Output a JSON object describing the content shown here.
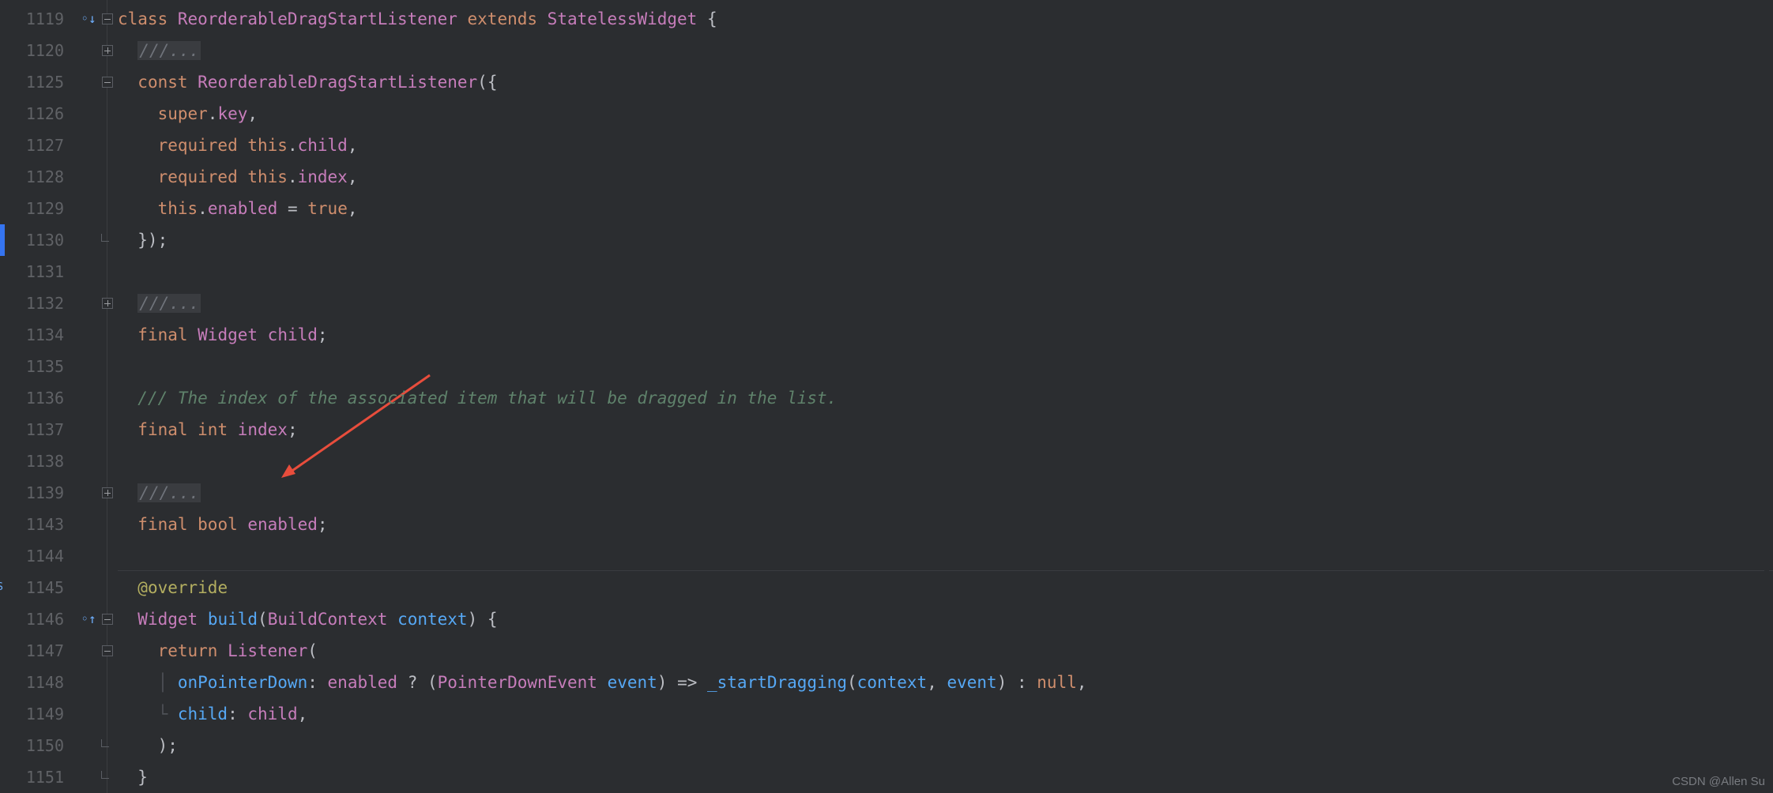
{
  "gutter": {
    "lines": [
      "1119",
      "1120",
      "1125",
      "1126",
      "1127",
      "1128",
      "1129",
      "1130",
      "1131",
      "1132",
      "1134",
      "1135",
      "1136",
      "1137",
      "1138",
      "1139",
      "1143",
      "1144",
      "1145",
      "1146",
      "1147",
      "1148",
      "1149",
      "1150",
      "1151"
    ]
  },
  "marks": {
    "l0": "◦↓",
    "l19": "◦↑",
    "extra_left_char": "S"
  },
  "code": {
    "l0": {
      "segments": [
        {
          "c": "kw",
          "t": "class "
        },
        {
          "c": "type",
          "t": "ReorderableDragStartListener "
        },
        {
          "c": "kw",
          "t": "extends "
        },
        {
          "c": "type",
          "t": "StatelessWidget "
        },
        {
          "c": "pn",
          "t": "{"
        }
      ]
    },
    "l1": {
      "segments": [
        {
          "c": "pn",
          "t": "  "
        },
        {
          "c": "comment",
          "t": "///..."
        }
      ]
    },
    "l2": {
      "segments": [
        {
          "c": "pn",
          "t": "  "
        },
        {
          "c": "kw",
          "t": "const "
        },
        {
          "c": "type",
          "t": "ReorderableDragStartListener"
        },
        {
          "c": "pn",
          "t": "({"
        }
      ]
    },
    "l3": {
      "segments": [
        {
          "c": "pn",
          "t": "    "
        },
        {
          "c": "kw",
          "t": "super"
        },
        {
          "c": "pn",
          "t": "."
        },
        {
          "c": "prop",
          "t": "key"
        },
        {
          "c": "pn",
          "t": ","
        }
      ]
    },
    "l4": {
      "segments": [
        {
          "c": "pn",
          "t": "    "
        },
        {
          "c": "kw",
          "t": "required "
        },
        {
          "c": "thiskw",
          "t": "this"
        },
        {
          "c": "pn",
          "t": "."
        },
        {
          "c": "prop",
          "t": "child"
        },
        {
          "c": "pn",
          "t": ","
        }
      ]
    },
    "l5": {
      "segments": [
        {
          "c": "pn",
          "t": "    "
        },
        {
          "c": "kw",
          "t": "required "
        },
        {
          "c": "thiskw",
          "t": "this"
        },
        {
          "c": "pn",
          "t": "."
        },
        {
          "c": "prop",
          "t": "index"
        },
        {
          "c": "pn",
          "t": ","
        }
      ]
    },
    "l6": {
      "segments": [
        {
          "c": "pn",
          "t": "    "
        },
        {
          "c": "thiskw",
          "t": "this"
        },
        {
          "c": "pn",
          "t": "."
        },
        {
          "c": "prop",
          "t": "enabled"
        },
        {
          "c": "pn",
          "t": " = "
        },
        {
          "c": "lit",
          "t": "true"
        },
        {
          "c": "pn",
          "t": ","
        }
      ]
    },
    "l7": {
      "segments": [
        {
          "c": "pn",
          "t": "  });"
        }
      ]
    },
    "l8": {
      "segments": [
        {
          "c": "pn",
          "t": ""
        }
      ]
    },
    "l9": {
      "segments": [
        {
          "c": "pn",
          "t": "  "
        },
        {
          "c": "comment",
          "t": "///..."
        }
      ]
    },
    "l10": {
      "segments": [
        {
          "c": "pn",
          "t": "  "
        },
        {
          "c": "kw",
          "t": "final "
        },
        {
          "c": "type",
          "t": "Widget "
        },
        {
          "c": "prop",
          "t": "child"
        },
        {
          "c": "pn",
          "t": ";"
        }
      ]
    },
    "l11": {
      "segments": [
        {
          "c": "pn",
          "t": ""
        }
      ]
    },
    "l12": {
      "segments": [
        {
          "c": "pn",
          "t": "  "
        },
        {
          "c": "doccomment",
          "t": "/// The index of the associated item that will be dragged in the list."
        }
      ]
    },
    "l13": {
      "segments": [
        {
          "c": "pn",
          "t": "  "
        },
        {
          "c": "kw",
          "t": "final "
        },
        {
          "c": "kw",
          "t": "int "
        },
        {
          "c": "prop",
          "t": "index"
        },
        {
          "c": "pn",
          "t": ";"
        }
      ]
    },
    "l14": {
      "segments": [
        {
          "c": "pn",
          "t": ""
        }
      ]
    },
    "l15": {
      "segments": [
        {
          "c": "pn",
          "t": "  "
        },
        {
          "c": "comment",
          "t": "///..."
        }
      ]
    },
    "l16": {
      "segments": [
        {
          "c": "pn",
          "t": "  "
        },
        {
          "c": "kw",
          "t": "final "
        },
        {
          "c": "kw",
          "t": "bool "
        },
        {
          "c": "prop",
          "t": "enabled"
        },
        {
          "c": "pn",
          "t": ";"
        }
      ]
    },
    "l17": {
      "segments": [
        {
          "c": "pn",
          "t": ""
        }
      ]
    },
    "l18": {
      "segments": [
        {
          "c": "pn",
          "t": "  "
        },
        {
          "c": "ann",
          "t": "@override"
        }
      ]
    },
    "l19": {
      "segments": [
        {
          "c": "pn",
          "t": "  "
        },
        {
          "c": "type",
          "t": "Widget "
        },
        {
          "c": "mtd",
          "t": "build"
        },
        {
          "c": "pn",
          "t": "("
        },
        {
          "c": "type",
          "t": "BuildContext "
        },
        {
          "c": "par",
          "t": "context"
        },
        {
          "c": "pn",
          "t": ") {"
        }
      ]
    },
    "l20": {
      "segments": [
        {
          "c": "pn",
          "t": "    "
        },
        {
          "c": "kw",
          "t": "return "
        },
        {
          "c": "type",
          "t": "Listener"
        },
        {
          "c": "pn",
          "t": "("
        }
      ]
    },
    "l21": {
      "segments": [
        {
          "c": "guide",
          "t": "    │ "
        },
        {
          "c": "par",
          "t": "onPointerDown"
        },
        {
          "c": "pn",
          "t": ": "
        },
        {
          "c": "prop",
          "t": "enabled"
        },
        {
          "c": "pn",
          "t": " ? ("
        },
        {
          "c": "type",
          "t": "PointerDownEvent "
        },
        {
          "c": "par",
          "t": "event"
        },
        {
          "c": "pn",
          "t": ") => "
        },
        {
          "c": "mtd",
          "t": "_startDragging"
        },
        {
          "c": "pn",
          "t": "("
        },
        {
          "c": "par",
          "t": "context"
        },
        {
          "c": "pn",
          "t": ", "
        },
        {
          "c": "par",
          "t": "event"
        },
        {
          "c": "pn",
          "t": ") : "
        },
        {
          "c": "lit",
          "t": "null"
        },
        {
          "c": "pn",
          "t": ","
        }
      ]
    },
    "l22": {
      "segments": [
        {
          "c": "guide",
          "t": "    └ "
        },
        {
          "c": "par",
          "t": "child"
        },
        {
          "c": "pn",
          "t": ": "
        },
        {
          "c": "prop",
          "t": "child"
        },
        {
          "c": "pn",
          "t": ","
        }
      ]
    },
    "l23": {
      "segments": [
        {
          "c": "pn",
          "t": "    );"
        }
      ]
    },
    "l24": {
      "segments": [
        {
          "c": "pn",
          "t": "  }"
        }
      ]
    }
  },
  "fold": {
    "minus_rows": [
      0,
      2,
      19,
      20
    ],
    "plus_rows": [
      1,
      9,
      15
    ],
    "end_rows": [
      7,
      23,
      24
    ]
  },
  "separator_row": 18,
  "watermark": "CSDN @Allen Su"
}
